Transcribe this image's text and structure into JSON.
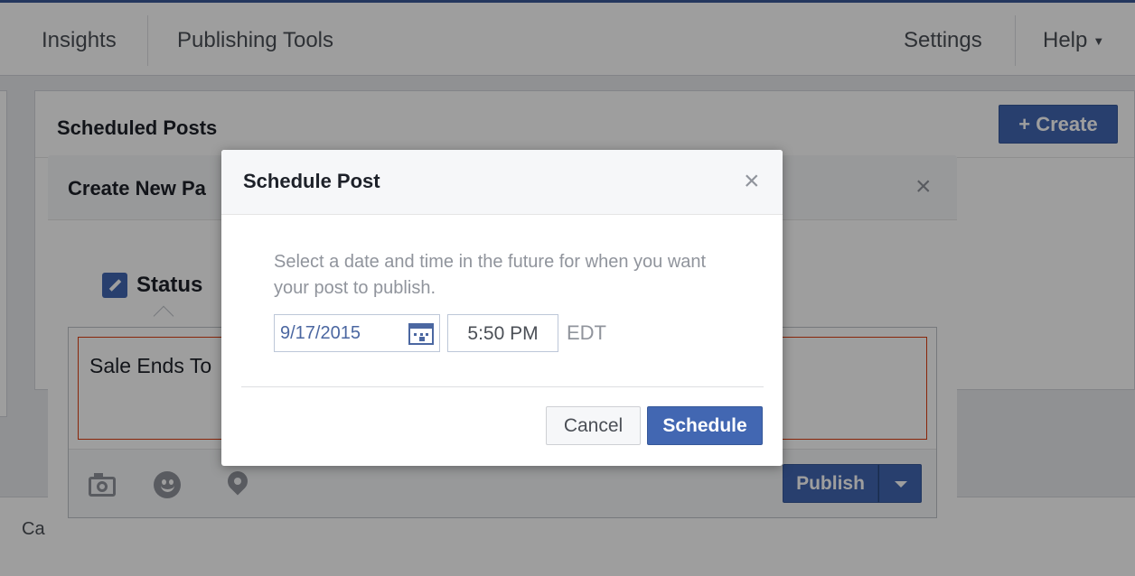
{
  "topbar": {
    "tabs": [
      "Insights",
      "Publishing Tools"
    ],
    "settings_label": "Settings",
    "help_label": "Help"
  },
  "main": {
    "title": "Scheduled Posts",
    "create_label": "+ Create"
  },
  "footer": {
    "text": "Ca"
  },
  "post_dialog": {
    "title": "Create New Pa",
    "close_glyph": "×",
    "status_label": "Status",
    "composer_text": "Sale Ends To",
    "publish_label": "Publish"
  },
  "schedule_dialog": {
    "title": "Schedule Post",
    "close_glyph": "×",
    "description": "Select a date and time in the future for when you want your post to publish.",
    "date_value": "9/17/2015",
    "time_value": "5:50 PM",
    "timezone": "EDT",
    "cancel_label": "Cancel",
    "schedule_label": "Schedule"
  },
  "colors": {
    "brand": "#4267b2",
    "error_border": "#dd3c10"
  }
}
